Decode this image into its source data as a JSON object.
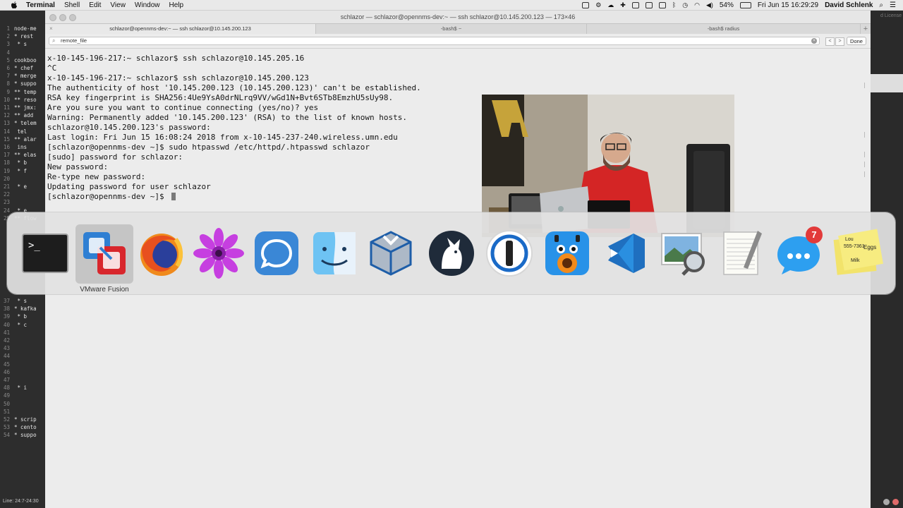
{
  "menubar": {
    "apple": "",
    "items": [
      "Terminal",
      "Shell",
      "Edit",
      "View",
      "Window",
      "Help"
    ],
    "battery": "54%",
    "clock": "Fri Jun 15  16:29:29",
    "user": "David Schlenk"
  },
  "editor": {
    "rows": [
      {
        "n": "1",
        "t": "node-me"
      },
      {
        "n": "2",
        "t": "* rest"
      },
      {
        "n": "3",
        "t": "    * s"
      },
      {
        "n": "4",
        "t": ""
      },
      {
        "n": "5",
        "t": "cookboo"
      },
      {
        "n": "6",
        "t": "* chef"
      },
      {
        "n": "7",
        "t": "* merge"
      },
      {
        "n": "8",
        "t": "* suppo"
      },
      {
        "n": "9",
        "t": "** temp"
      },
      {
        "n": "10",
        "t": "** reso"
      },
      {
        "n": "11",
        "t": "** jmx:"
      },
      {
        "n": "12",
        "t": "** add"
      },
      {
        "n": "13",
        "t": "* telem"
      },
      {
        "n": "14",
        "t": "    tel"
      },
      {
        "n": "15",
        "t": "** alar"
      },
      {
        "n": "16",
        "t": "    ins"
      },
      {
        "n": "17",
        "t": "** elas"
      },
      {
        "n": "18",
        "t": "    * b"
      },
      {
        "n": "19",
        "t": "    * f"
      },
      {
        "n": "20",
        "t": ""
      },
      {
        "n": "21",
        "t": "    * e"
      },
      {
        "n": "22",
        "t": ""
      },
      {
        "n": "23",
        "t": ""
      },
      {
        "n": "24",
        "t": "    * e"
      },
      {
        "n": "25",
        "t": "** flow"
      }
    ],
    "rows_lower": [
      {
        "n": "37",
        "t": "    * s"
      },
      {
        "n": "38",
        "t": "* kafka"
      },
      {
        "n": "39",
        "t": "    * b"
      },
      {
        "n": "40",
        "t": "    * c"
      },
      {
        "n": "41",
        "t": ""
      },
      {
        "n": "42",
        "t": ""
      },
      {
        "n": "43",
        "t": ""
      },
      {
        "n": "44",
        "t": ""
      },
      {
        "n": "45",
        "t": ""
      },
      {
        "n": "46",
        "t": ""
      },
      {
        "n": "47",
        "t": ""
      },
      {
        "n": "48",
        "t": "    * i"
      },
      {
        "n": "49",
        "t": ""
      },
      {
        "n": "50",
        "t": ""
      },
      {
        "n": "51",
        "t": ""
      },
      {
        "n": "52",
        "t": "* scrip"
      },
      {
        "n": "53",
        "t": "* cento"
      },
      {
        "n": "54",
        "t": "* suppo"
      }
    ],
    "status": "Line: 24:7-24:30"
  },
  "right_app": {
    "license": "d License"
  },
  "window": {
    "title": "schlazor — schlazor@opennms-dev:~ — ssh schlazor@10.145.200.123 — 173×46",
    "tabs": [
      {
        "label": "schlazor@opennms-dev:~ — ssh schlazor@10.145.200.123",
        "active": true
      },
      {
        "label": "-bash$ ~",
        "active": false
      },
      {
        "label": "-bash$ radius",
        "active": false
      }
    ],
    "find": {
      "value": "remote_file",
      "done": "Done",
      "prev": "<",
      "next": ">"
    }
  },
  "console_lines": [
    "x-10-145-196-217:~ schlazor$ ssh schlazor@10.145.205.16",
    "^C",
    "x-10-145-196-217:~ schlazor$ ssh schlazor@10.145.200.123",
    "The authenticity of host '10.145.200.123 (10.145.200.123)' can't be established.",
    "RSA key fingerprint is SHA256:4Ue9YsA0drNLrq9VV/wGd1N+Bvt6STb8EmzhU5sUy98.",
    "Are you sure you want to continue connecting (yes/no)? yes",
    "Warning: Permanently added '10.145.200.123' (RSA) to the list of known hosts.",
    "schlazor@10.145.200.123's password:",
    "Last login: Fri Jun 15 16:08:24 2018 from x-10-145-237-240.wireless.umn.edu",
    "[schlazor@opennms-dev ~]$ sudo htpasswd /etc/httpd/.htpasswd schlazor",
    "[sudo] password for schlazor:",
    "New password:",
    "Re-type new password:",
    "Updating password for user schlazor",
    "[schlazor@opennms-dev ~]$ "
  ],
  "dock": {
    "tooltip": "VMware Fusion",
    "apps": [
      {
        "icon": "terminal-icon"
      },
      {
        "icon": "vmware-fusion-icon"
      },
      {
        "icon": "firefox-icon"
      },
      {
        "icon": "flower-icon"
      },
      {
        "icon": "signal-icon"
      },
      {
        "icon": "finder-icon"
      },
      {
        "icon": "virtualbox-icon"
      },
      {
        "icon": "goat-icon"
      },
      {
        "icon": "1password-icon"
      },
      {
        "icon": "tweetbot-icon"
      },
      {
        "icon": "vscode-icon"
      },
      {
        "icon": "preview-icon"
      },
      {
        "icon": "textedit-icon"
      },
      {
        "icon": "messages-icon"
      },
      {
        "icon": "stickies-icon"
      }
    ],
    "messages_badge": "7",
    "sticky_lines": [
      "Lou",
      "555-7361",
      "Eggs",
      "Milk"
    ]
  }
}
